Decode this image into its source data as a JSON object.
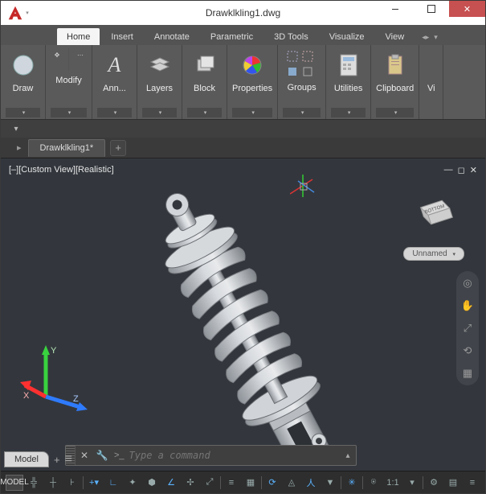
{
  "titlebar": {
    "title": "Drawklkling1.dwg"
  },
  "ribbon_tabs": {
    "items": [
      "Home",
      "Insert",
      "Annotate",
      "Parametric",
      "3D Tools",
      "Visualize",
      "View"
    ],
    "active_index": 0
  },
  "ribbon_panels": {
    "draw": "Draw",
    "modify": "Modify",
    "annotate": "Ann...",
    "layers": "Layers",
    "block": "Block",
    "properties": "Properties",
    "groups": "Groups",
    "utilities": "Utilities",
    "clipboard": "Clipboard",
    "view": "Vi"
  },
  "drawing_tabs": {
    "active": "Drawklkling1*"
  },
  "viewport": {
    "label": "[–][Custom View][Realistic]",
    "viewcube_face": "BOTTOM",
    "unnamed_badge": "Unnamed",
    "ucs": {
      "x": "X",
      "y": "Y",
      "z": "Z"
    }
  },
  "commandline": {
    "icon": "✕",
    "wrench": "🔧",
    "prompt_glyph": ">_",
    "placeholder": "Type a command"
  },
  "layout_tabs": {
    "model": "Model"
  },
  "statusbar": {
    "model": "MODEL",
    "scale": "1:1",
    "items": {
      "grid": "grid",
      "snap": "snap",
      "constraint": "constraint",
      "dyn": "dyn",
      "ortho": "ortho",
      "polar": "polar",
      "iso": "iso",
      "osnap": "osnap",
      "gizmo": "gizmo",
      "ann": "ann",
      "cycle": "cycle",
      "person": "person",
      "filter": "filter",
      "gear": "gear",
      "menu": "menu"
    }
  }
}
